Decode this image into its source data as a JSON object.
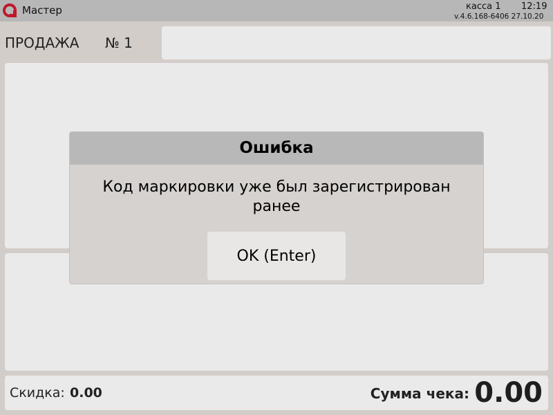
{
  "topbar": {
    "app_name": "Мастер",
    "kassa": "касса 1",
    "time": "12:19",
    "version": "v.4.6.168-6406  27.10.20",
    "logo_color": "#c0182b"
  },
  "sale": {
    "title": "ПРОДАЖА",
    "number": "№ 1",
    "input_value": ""
  },
  "footer": {
    "discount_label": "Скидка:",
    "discount_value": "0.00",
    "total_label": "Сумма чека:",
    "total_value": "0.00"
  },
  "dialog": {
    "title": "Ошибка",
    "message": "Код маркировки уже был зарегистрирован ранее",
    "ok_label": "OK (Enter)"
  }
}
